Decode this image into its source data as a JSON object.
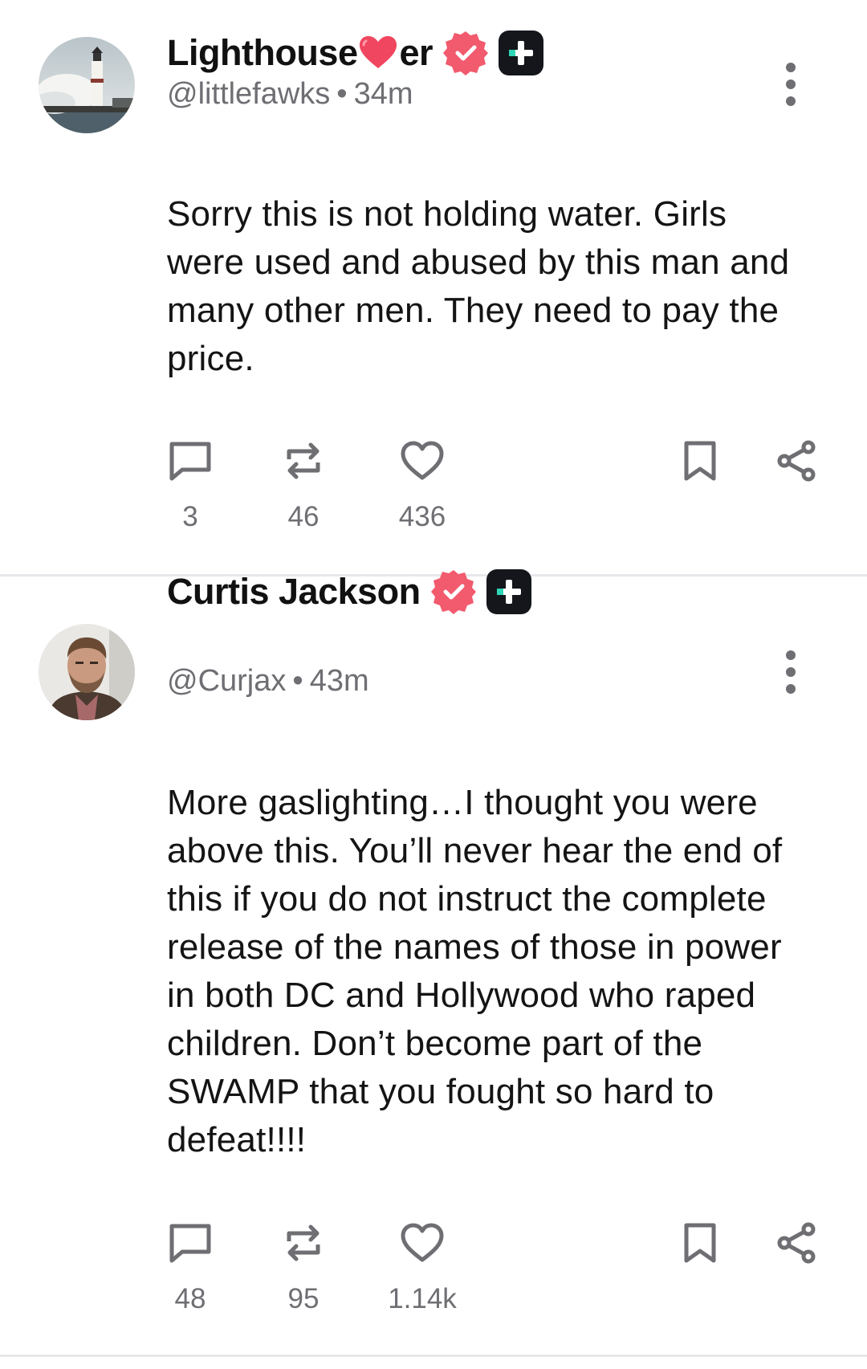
{
  "posts": [
    {
      "display_name_before": "Lighthouse",
      "display_name_after": "er",
      "handle": "@littlefawks",
      "time": "34m",
      "body": "Sorry this is not holding water. Girls were used and abused by this man and many other men. They need to pay the price.",
      "counts": {
        "replies": "3",
        "reposts": "46",
        "likes": "436"
      },
      "avatar": "lighthouse-photo"
    },
    {
      "display_name": "Curtis Jackson",
      "handle": "@Curjax",
      "time": "43m",
      "body": "More gaslighting…I thought you were above this. You’ll never hear the end of this if you do not instruct the complete release of the names of those in power in both DC and Hollywood who raped children. Don’t become part of the SWAMP that you fought so hard to defeat!!!!",
      "counts": {
        "replies": "48",
        "reposts": "95",
        "likes": "1.14k"
      },
      "avatar": "man-portrait-photo"
    }
  ],
  "separator": "•",
  "colors": {
    "verified": "#f25a6e",
    "accent": "#2fd6b5",
    "icon": "#6e6e73",
    "heart": "#f0465f"
  },
  "icons": [
    "verified-icon",
    "plus-badge-icon",
    "more-icon",
    "reply-icon",
    "repost-icon",
    "like-icon",
    "bookmark-icon",
    "share-icon"
  ]
}
